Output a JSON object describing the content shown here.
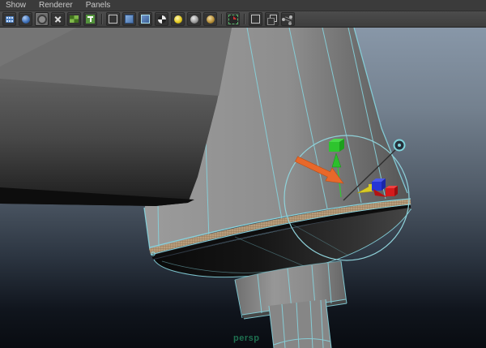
{
  "menu_bar": {
    "items": [
      {
        "label": "Show"
      },
      {
        "label": "Renderer"
      },
      {
        "label": "Panels"
      }
    ]
  },
  "toolbar": {
    "icon_names": [
      "filmstrip",
      "camera-attributes",
      "grease-pencil",
      "film-gate",
      "resolution-gate",
      "texture-borders",
      "wireframe",
      "smooth-shade",
      "wireframe-on-shaded",
      "textured",
      "lights",
      "shadows",
      "occlusion",
      "isolate-select",
      "xray",
      "xray-active-components",
      "plugin-connections"
    ],
    "pressed_icon": "grease-pencil"
  },
  "viewport": {
    "camera_label": "persp",
    "scene_description": "lamp-shade cone with rim selected, stepped cylinder stem below, dark slab body above-left",
    "colors": {
      "background_top": "#8897a8",
      "background_bottom": "#090c11",
      "selection_wireframe": "#86d4de",
      "annotation_arrow": "#e8682a",
      "rim_band": "#b89d7c",
      "manipulator_x_axis": "#d41b1b",
      "manipulator_y_axis": "#2ec42e",
      "manipulator_z_axis": "#2636d6",
      "manipulator_active": "#d8ca25",
      "camera_label_color": "#1e7050",
      "menubar_background": "#3b3b3b"
    }
  }
}
